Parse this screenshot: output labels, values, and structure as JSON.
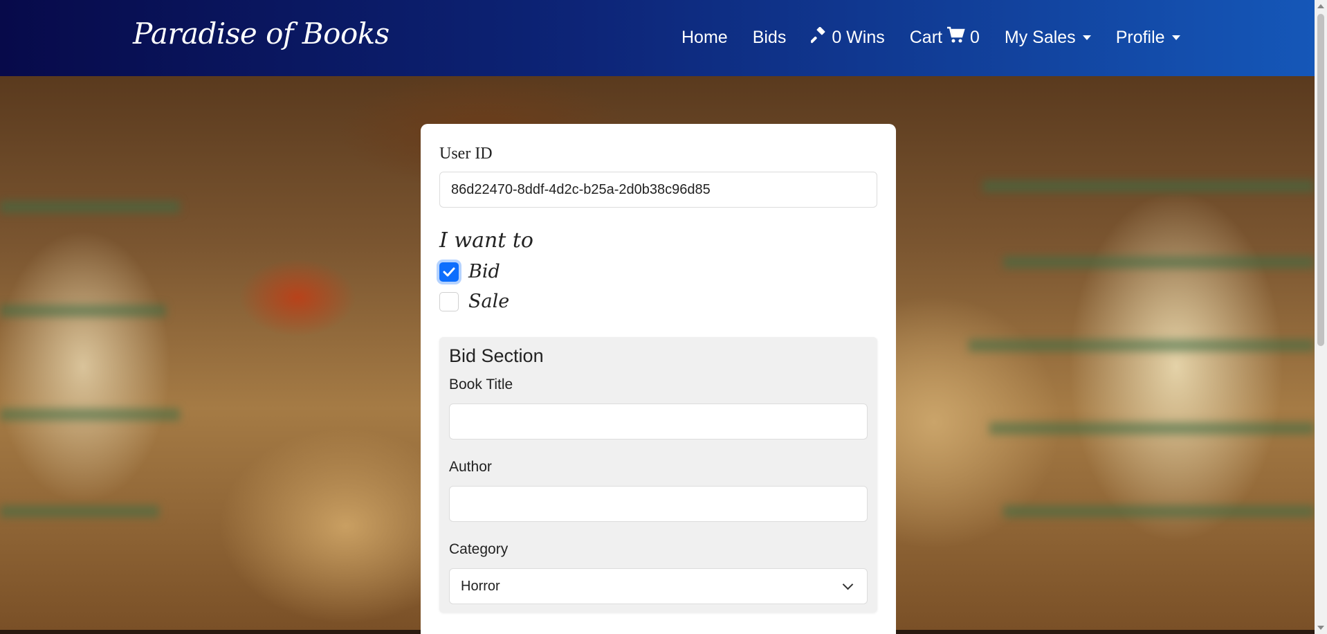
{
  "navbar": {
    "brand": "Paradise of Books",
    "links": {
      "home": "Home",
      "bids": "Bids",
      "wins": "0 Wins",
      "cart": "Cart",
      "cart_count": "0",
      "my_sales": "My Sales",
      "profile": "Profile"
    }
  },
  "form": {
    "user_id_label": "User ID",
    "user_id_value": "86d22470-8ddf-4d2c-b25a-2d0b38c96d85",
    "intent_heading": "I want to",
    "options": {
      "bid": {
        "label": "Bid",
        "checked": true
      },
      "sale": {
        "label": "Sale",
        "checked": false
      }
    },
    "bid_section": {
      "title": "Bid Section",
      "book_title_label": "Book Title",
      "book_title_value": "",
      "author_label": "Author",
      "author_value": "",
      "category_label": "Category",
      "category_value": "Horror"
    }
  },
  "colors": {
    "navbar_start": "#070a4a",
    "navbar_end": "#1557b8",
    "checkbox_accent": "#0d6efd"
  }
}
